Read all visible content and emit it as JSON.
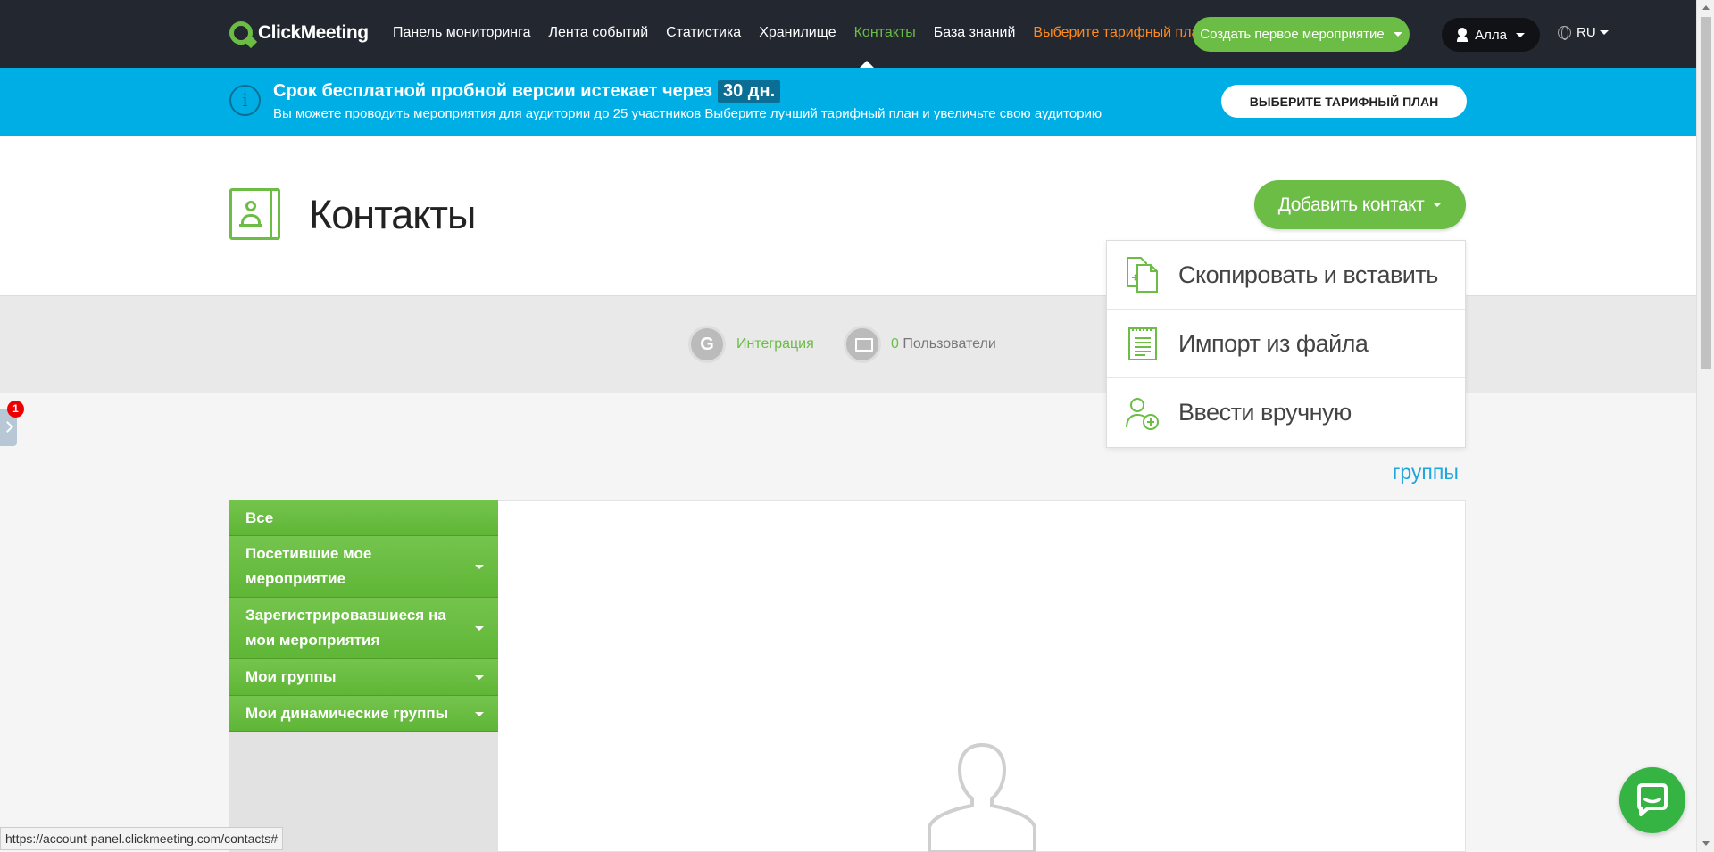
{
  "topbar": {
    "logo_text": "ClickMeeting",
    "nav": [
      {
        "label": "Панель мониторинга"
      },
      {
        "label": "Лента событий"
      },
      {
        "label": "Статистика"
      },
      {
        "label": "Хранилище"
      },
      {
        "label": "Контакты",
        "active": true
      },
      {
        "label": "База знаний"
      },
      {
        "label": "Выберите тарифный план"
      }
    ],
    "create_button": "Создать первое мероприятие",
    "user_name": "Алла",
    "language": "RU"
  },
  "banner": {
    "title": "Срок бесплатной пробной версии истекает через",
    "days": "30 дн.",
    "subtitle": "Вы можете проводить мероприятия для аудитории до 25 участников Выберите лучший тарифный план и увеличьте свою аудиторию",
    "button": "ВЫБЕРИТЕ ТАРИФНЫЙ ПЛАН"
  },
  "page": {
    "title": "Контакты",
    "add_contact_button": "Добавить контакт"
  },
  "filters": {
    "integration_label": "Интеграция",
    "users_count": "0",
    "users_label": "Пользователи"
  },
  "dropdown": {
    "items": [
      {
        "label": "Скопировать и вставить",
        "icon": "copy-paste-icon"
      },
      {
        "label": "Импорт из файла",
        "icon": "file-import-icon"
      },
      {
        "label": "Ввести вручную",
        "icon": "add-user-icon"
      }
    ]
  },
  "side_tab": {
    "badge": "1"
  },
  "groups_link": "группы",
  "groups": [
    {
      "label": "Все",
      "has_caret": false
    },
    {
      "label": "Посетившие мое мероприятие",
      "has_caret": true
    },
    {
      "label": "Зарегистрировавшиеся на мои мероприятия",
      "has_caret": true
    },
    {
      "label": "Мои группы",
      "has_caret": true
    },
    {
      "label": "Мои динамические группы",
      "has_caret": true
    }
  ],
  "status_url": "https://account-panel.clickmeeting.com/contacts#",
  "colors": {
    "accent": "#6bbd45",
    "topbar": "#23272f",
    "banner": "#00aee6",
    "plan_link": "#ff8a1f",
    "groups_link": "#1fa6df"
  }
}
